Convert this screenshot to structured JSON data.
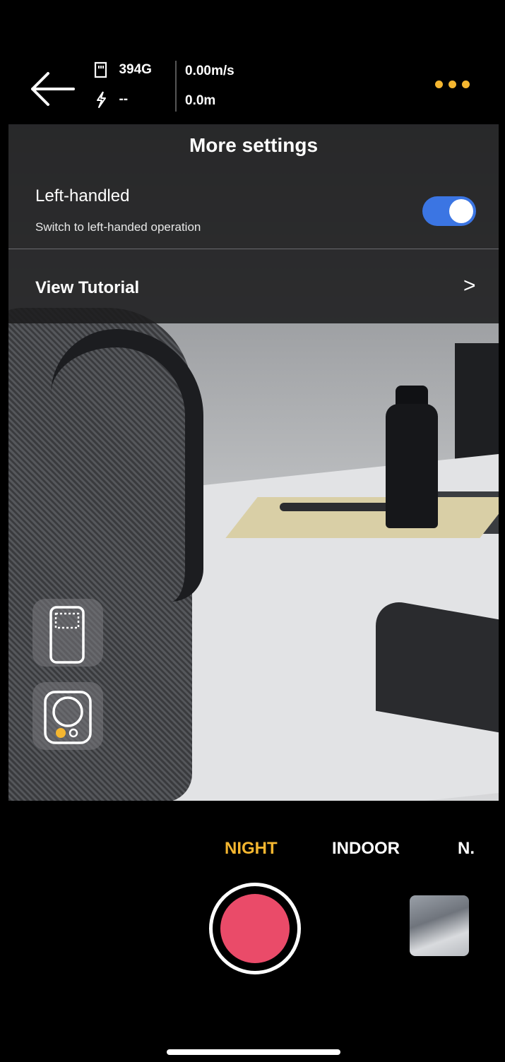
{
  "status": {
    "storage": "394G",
    "battery": "--",
    "speed": "0.00m/s",
    "distance": "0.0m"
  },
  "settings_panel": {
    "title": "More settings",
    "left_handed_label": "Left-handled",
    "left_handed_desc": "Switch to left-handed operation",
    "left_handed_on": true,
    "tutorial_label": "View Tutorial",
    "chevron": ">"
  },
  "modes": {
    "items": [
      "NIGHT",
      "INDOOR",
      "N."
    ],
    "active": "NIGHT"
  },
  "icons": {
    "back": "arrow-left-icon",
    "storage": "sd-card-icon",
    "battery": "lightning-icon",
    "menu": "more-dots-icon",
    "frame": "frame-crop-icon",
    "device": "camera-device-icon"
  },
  "colors": {
    "accent": "#f4b630",
    "toggle_on": "#3b75e3",
    "shutter": "#ea4b69"
  }
}
